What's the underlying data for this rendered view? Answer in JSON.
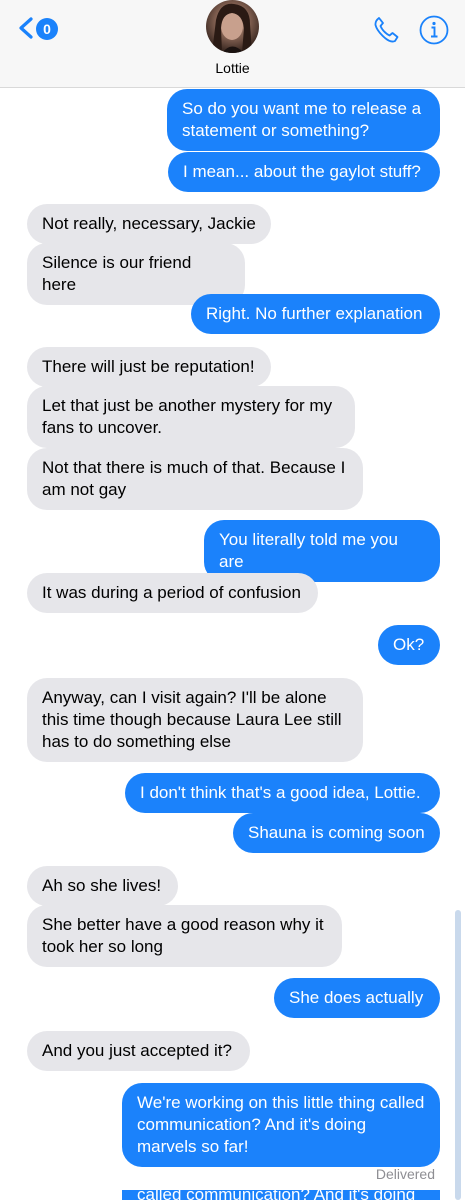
{
  "header": {
    "back_badge": "0",
    "contact_name": "Lottie"
  },
  "messages": [
    {
      "from": "me",
      "text": "So do you want me to release a statement or something?"
    },
    {
      "from": "me",
      "text": "I mean... about the gaylot stuff?"
    },
    {
      "from": "them",
      "text": "Not really, necessary, Jackie"
    },
    {
      "from": "them",
      "text": "Silence is our friend here"
    },
    {
      "from": "me",
      "text": "Right. No further explanation"
    },
    {
      "from": "them",
      "text": "There will just be reputation!"
    },
    {
      "from": "them",
      "text": "Let that just be another mystery for my fans to uncover."
    },
    {
      "from": "them",
      "text": "Not that there is much of that. Because I am not gay"
    },
    {
      "from": "me",
      "text": "You literally told me you are"
    },
    {
      "from": "them",
      "text": "It was during a period of confusion"
    },
    {
      "from": "me",
      "text": "Ok?"
    },
    {
      "from": "them",
      "text": "Anyway, can I visit again? I'll be alone this time though because Laura Lee still has to do something else"
    },
    {
      "from": "me",
      "text": "I don't think that's a good idea, Lottie."
    },
    {
      "from": "me",
      "text": "Shauna is coming soon"
    },
    {
      "from": "them",
      "text": "Ah so she lives!"
    },
    {
      "from": "them",
      "text": "She better have a good reason why it took her so long"
    },
    {
      "from": "me",
      "text": "She does actually"
    },
    {
      "from": "them",
      "text": "And you just accepted it?"
    },
    {
      "from": "me",
      "text": "We're working on this little thing called communication? And it's doing marvels so far!"
    }
  ],
  "status": "Delivered",
  "cutoff_text": "called communication? And it's doing",
  "colors": {
    "outgoing": "#1b82fb",
    "incoming": "#e6e6ea",
    "accent": "#1a82fb"
  }
}
